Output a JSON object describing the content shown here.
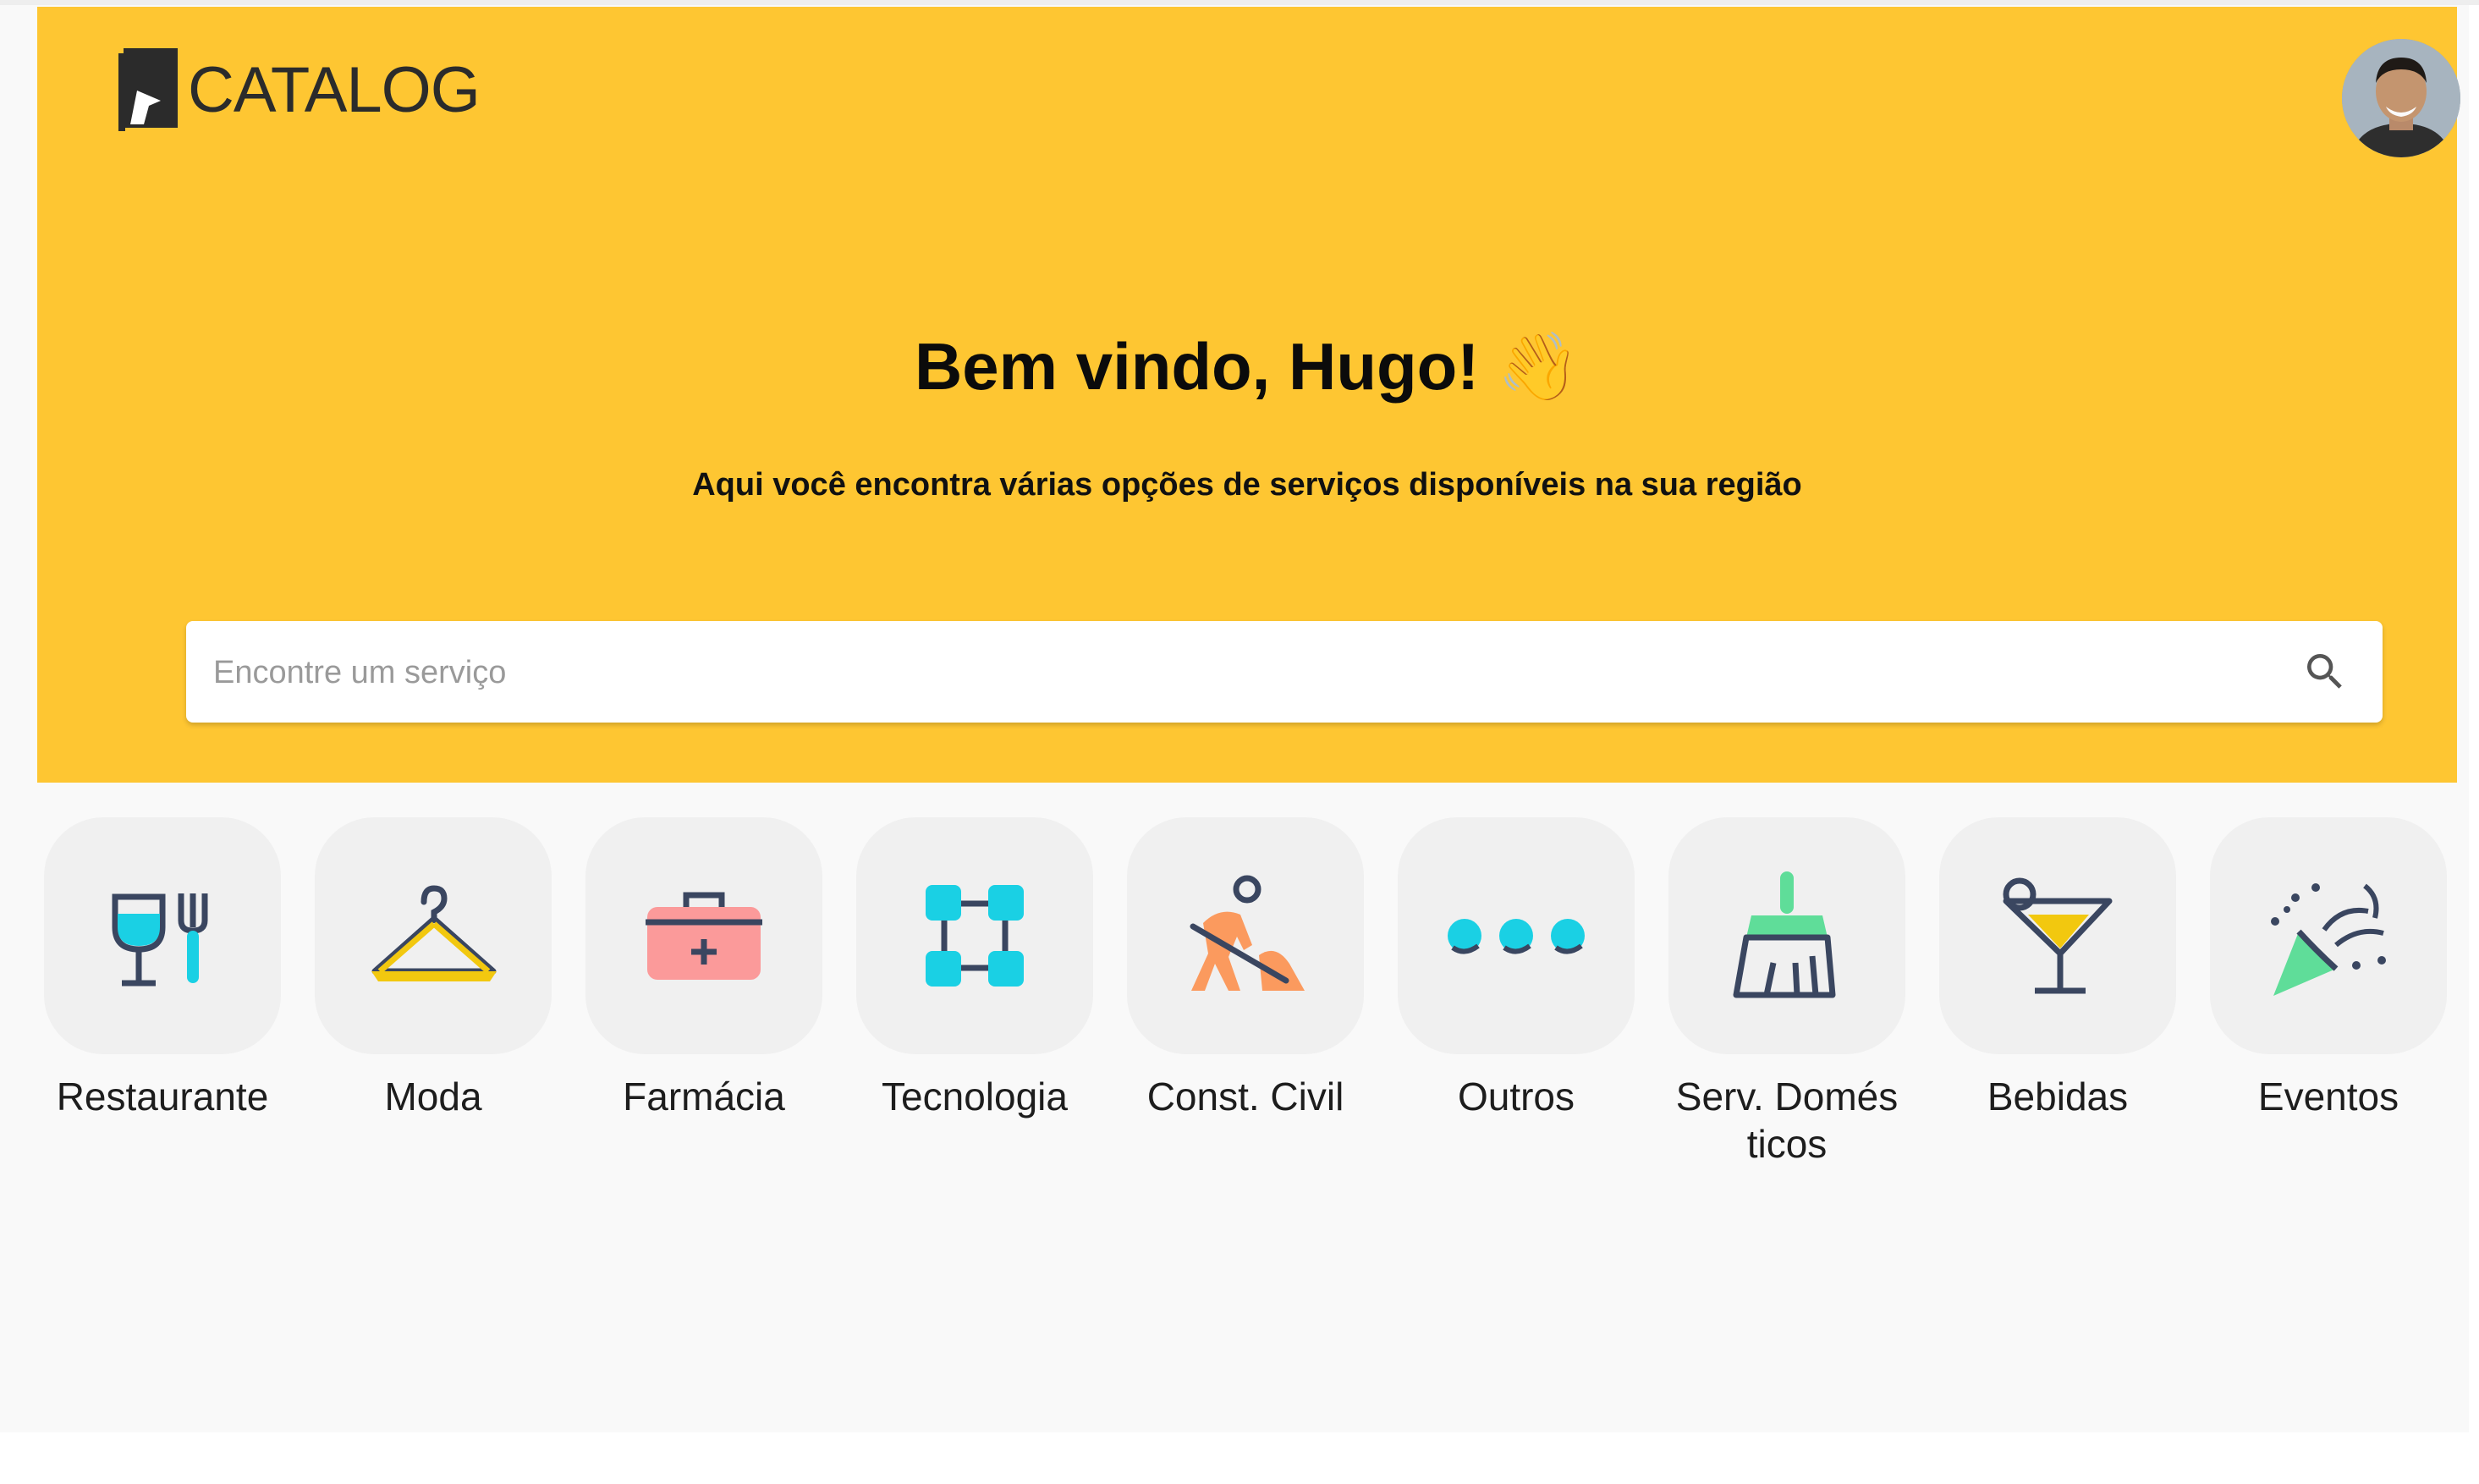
{
  "app": {
    "logo_text": "CATALOG"
  },
  "hero": {
    "greeting": "Bem vindo, Hugo! 👋",
    "subtitle": "Aqui você encontra várias opções de serviços disponíveis na sua região",
    "background_color": "#fec632"
  },
  "search": {
    "placeholder": "Encontre um serviço",
    "value": ""
  },
  "categories": [
    {
      "label": "Restaurante",
      "icon": "restaurant-icon"
    },
    {
      "label": "Moda",
      "icon": "hanger-icon"
    },
    {
      "label": "Farmácia",
      "icon": "first-aid-kit-icon"
    },
    {
      "label": "Tecnologia",
      "icon": "network-nodes-icon"
    },
    {
      "label": "Const. Civil",
      "icon": "construction-worker-icon"
    },
    {
      "label": "Outros",
      "icon": "more-dots-icon"
    },
    {
      "label": "Serv. Domés ticos",
      "icon": "broom-icon"
    },
    {
      "label": "Bebidas",
      "icon": "cocktail-icon"
    },
    {
      "label": "Eventos",
      "icon": "party-popper-icon"
    }
  ]
}
